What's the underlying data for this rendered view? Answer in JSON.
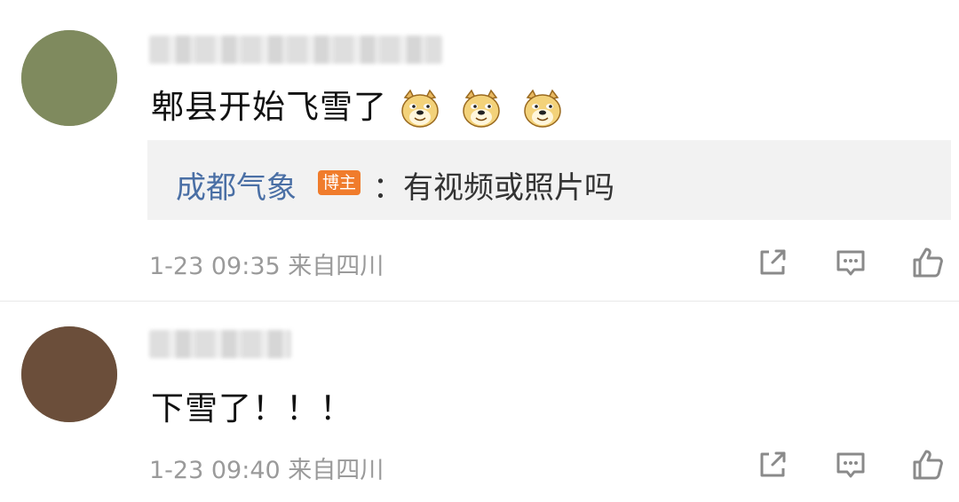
{
  "comments": [
    {
      "username": "■■ ■■■■■■■■■■",
      "text": "郫县开始飞雪了",
      "emoji": [
        "doge-emoji",
        "doge-emoji",
        "doge-emoji"
      ],
      "reply": {
        "author": "成都气象",
        "badge": "博主",
        "text": "：有视频或照片吗"
      },
      "time": "1-23 09:35",
      "location": "来自四川",
      "meta_text": "1-23 09:35  来自四川"
    },
    {
      "username": "■■■■■",
      "text": "下雪了！！！",
      "time": "1-23 09:40",
      "location": "来自四川",
      "meta_text": "1-23 09:40  来自四川"
    }
  ],
  "icons": {
    "share": "share-icon",
    "reply": "comment-icon",
    "like": "thumbs-up-icon"
  },
  "colors": {
    "reply_author": "#4a6fa5",
    "badge_bg": "#f07c2c",
    "reply_box_bg": "#f2f2f2",
    "meta": "#9a9a9a"
  }
}
